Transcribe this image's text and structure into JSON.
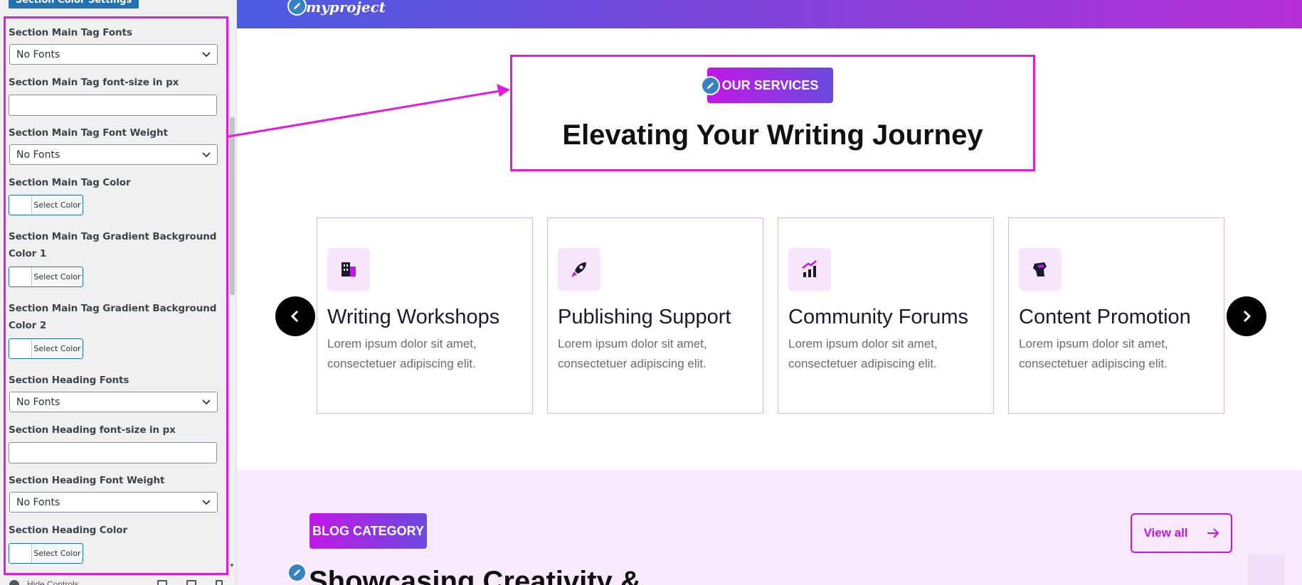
{
  "sidebar": {
    "top_button": "Section Color Settings",
    "fields": {
      "main_tag_fonts": {
        "label": "Section Main Tag Fonts",
        "value": "No Fonts"
      },
      "main_tag_font_size": {
        "label": "Section Main Tag font-size in px",
        "value": ""
      },
      "main_tag_font_weight": {
        "label": "Section Main Tag Font Weight",
        "value": "No Fonts"
      },
      "main_tag_color": {
        "label": "Section Main Tag Color",
        "button": "Select Color"
      },
      "main_tag_gradient_1": {
        "label_line1": "Section Main Tag Gradient Background",
        "label_line2": "Color 1",
        "button": "Select Color"
      },
      "main_tag_gradient_2": {
        "label_line1": "Section Main Tag Gradient Background",
        "label_line2": "Color 2",
        "button": "Select Color"
      },
      "heading_fonts": {
        "label": "Section Heading Fonts",
        "value": "No Fonts"
      },
      "heading_font_size": {
        "label": "Section Heading font-size in px",
        "value": ""
      },
      "heading_font_weight": {
        "label": "Section Heading Font Weight",
        "value": "No Fonts"
      },
      "heading_color": {
        "label": "Section Heading Color",
        "button": "Select Color"
      }
    },
    "bottom": {
      "hide_controls": "Hide Controls"
    }
  },
  "preview": {
    "logo": "myproject",
    "services": {
      "tag": "OUR SERVICES",
      "title": "Elevating Your Writing Journey",
      "cards": [
        {
          "icon": "building-icon",
          "title": "Writing Workshops",
          "text": "Lorem ipsum dolor sit amet, consectetuer adipiscing elit."
        },
        {
          "icon": "rocket-icon",
          "title": "Publishing Support",
          "text": "Lorem ipsum dolor sit amet, consectetuer adipiscing elit."
        },
        {
          "icon": "chart-up-icon",
          "title": "Community Forums",
          "text": "Lorem ipsum dolor sit amet, consectetuer adipiscing elit."
        },
        {
          "icon": "fist-icon",
          "title": "Content Promotion",
          "text": "Lorem ipsum dolor sit amet, consectetuer adipiscing elit."
        }
      ]
    },
    "blog": {
      "tag": "BLOG CATEGORY",
      "view_all": "View all",
      "title": "Showcasing Creativity &"
    }
  },
  "colors": {
    "highlight": "#e21be0",
    "accent": "#c117e6",
    "wp_blue": "#2271b1"
  }
}
